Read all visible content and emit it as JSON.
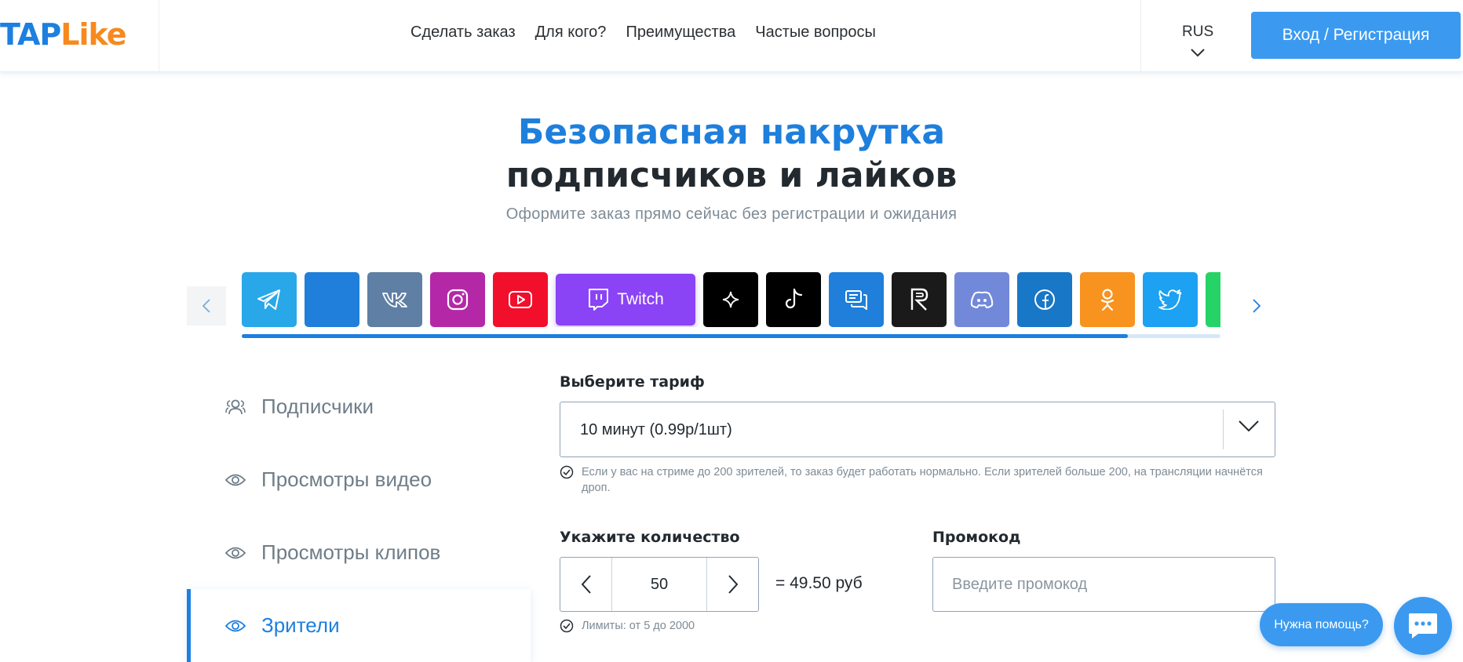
{
  "brand": {
    "part1": "TAP",
    "part2": "Like"
  },
  "nav": [
    "Сделать заказ",
    "Для кого?",
    "Преимущества",
    "Частые вопросы"
  ],
  "lang": "RUS",
  "login_label": "Вход / Регистрация",
  "hero": {
    "title_line1": "Безопасная накрутка",
    "title_line2": "подписчиков и лайков",
    "subtitle": "Оформите заказ прямо сейчас без регистрации и ожидания"
  },
  "platforms": [
    {
      "name": "telegram",
      "color": "#28a8e9"
    },
    {
      "name": "vk-blue",
      "color": "#1f7fdb"
    },
    {
      "name": "vk",
      "color": "#5f7fa5"
    },
    {
      "name": "instagram",
      "color": "#b428a8"
    },
    {
      "name": "youtube",
      "color": "#f20f2c"
    },
    {
      "name": "twitch",
      "color": "#8a43f5",
      "label": "Twitch",
      "selected": true
    },
    {
      "name": "sparkle",
      "color": "#000000"
    },
    {
      "name": "tiktok",
      "color": "#000000"
    },
    {
      "name": "messages",
      "color": "#1f7fdb"
    },
    {
      "name": "rutube",
      "color": "#1a1a1a"
    },
    {
      "name": "discord",
      "color": "#7289da"
    },
    {
      "name": "facebook",
      "color": "#1877c7"
    },
    {
      "name": "odnoklassniki",
      "color": "#f7931e"
    },
    {
      "name": "twitter",
      "color": "#1da1f2"
    },
    {
      "name": "whatsapp",
      "color": "#25d366"
    }
  ],
  "carousel_progress": 0.905,
  "services": [
    {
      "label": "Подписчики",
      "icon": "users-icon",
      "active": false
    },
    {
      "label": "Просмотры видео",
      "icon": "eye-icon",
      "active": false
    },
    {
      "label": "Просмотры клипов",
      "icon": "eye-icon",
      "active": false
    },
    {
      "label": "Зрители",
      "icon": "eye-icon",
      "active": true
    }
  ],
  "tariff": {
    "label": "Выберите тариф",
    "value": "10 минут (0.99р/1шт)",
    "note": "Если у вас на стриме до 200 зрителей, то заказ будет работать нормально. Если зрителей больше 200, на трансляции начнётся дроп."
  },
  "quantity": {
    "label": "Укажите количество",
    "value": "50",
    "total": "= 49.50 руб",
    "limits": "Лимиты: от 5 до 2000"
  },
  "promo": {
    "label": "Промокод",
    "placeholder": "Введите промокод"
  },
  "help_label": "Нужна помощь?",
  "colors": {
    "accent": "#1d7fe0",
    "button": "#3b9af0",
    "brand_orange": "#f68a1e"
  }
}
